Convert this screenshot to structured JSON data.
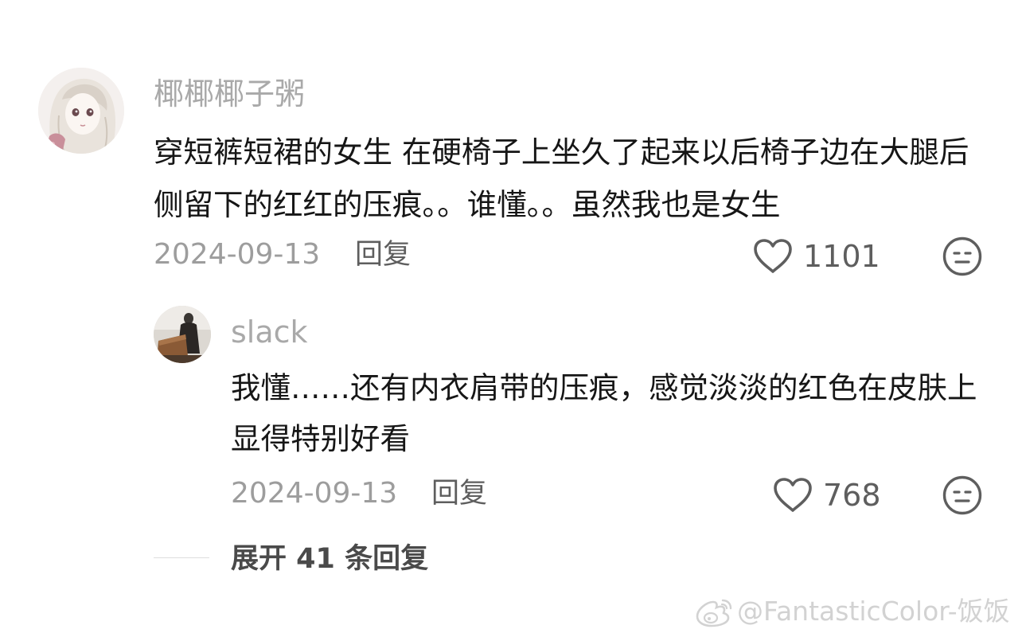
{
  "comments": [
    {
      "username": "椰椰椰子粥",
      "text": "穿短裤短裙的女生 在硬椅子上坐久了起来以后椅子边在大腿后侧留下的红红的压痕。。谁懂。。虽然我也是女生",
      "date": "2024-09-13",
      "reply_label": "回复",
      "likes": "1101",
      "avatar_icon": "anime-girl-avatar",
      "like_icon": "heart-outline-icon",
      "dislike_icon": "meh-face-icon"
    },
    {
      "username": "slack",
      "text": "我懂……还有内衣肩带的压痕，感觉淡淡的红色在皮肤上显得特别好看",
      "date": "2024-09-13",
      "reply_label": "回复",
      "likes": "768",
      "avatar_icon": "photo-avatar",
      "like_icon": "heart-outline-icon",
      "dislike_icon": "meh-face-icon"
    }
  ],
  "expand": {
    "label": "展开 41 条回复"
  },
  "watermark": {
    "text": "@FantasticColor-饭饭",
    "icon": "weibo-logo-icon"
  },
  "colors": {
    "username": "#a9a9a9",
    "body_text": "#161616",
    "meta_text": "#9d9d9d",
    "action_text": "#5e5e5e",
    "watermark": "#d2d2d2"
  }
}
